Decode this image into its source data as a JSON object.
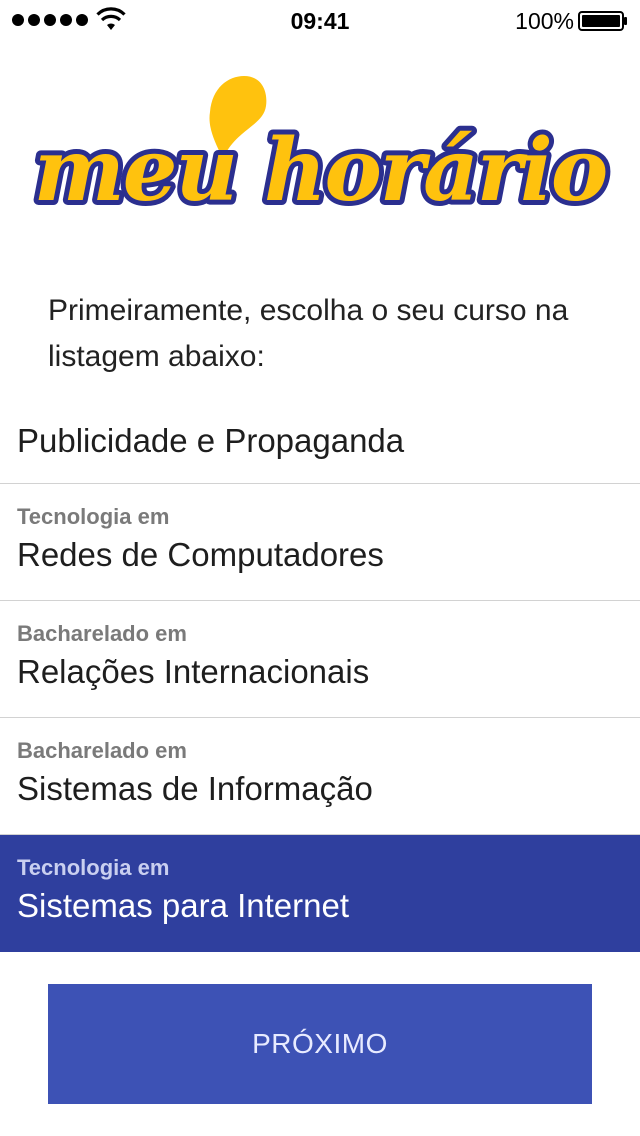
{
  "status_bar": {
    "time": "09:41",
    "battery_percent": "100%",
    "signal_bars": 5
  },
  "logo": {
    "text": "meu horário",
    "colors": {
      "fill": "#ffc20e",
      "outline": "#2b2f8f"
    }
  },
  "instruction": "Primeiramente, escolha o seu curso na listagem abaixo:",
  "courses": [
    {
      "degree": "",
      "name": "Publicidade e Propaganda",
      "selected": false
    },
    {
      "degree": "Tecnologia em",
      "name": "Redes de Computadores",
      "selected": false
    },
    {
      "degree": "Bacharelado em",
      "name": "Relações Internacionais",
      "selected": false
    },
    {
      "degree": "Bacharelado em",
      "name": "Sistemas de Informação",
      "selected": false
    },
    {
      "degree": "Tecnologia em",
      "name": "Sistemas para Internet",
      "selected": true
    }
  ],
  "next_button": {
    "label": "PRÓXIMO"
  },
  "colors": {
    "accent": "#3d52b5",
    "selected_row": "#2f3f9e"
  }
}
